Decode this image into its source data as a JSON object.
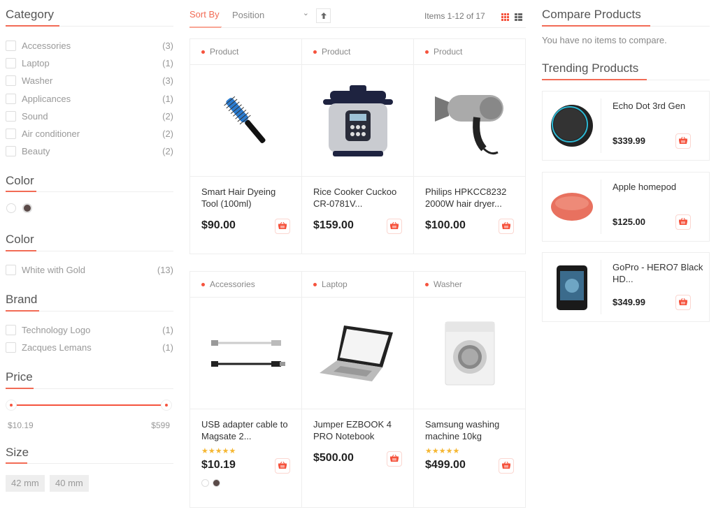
{
  "colors": {
    "accent": "#f5533d",
    "rating": "#f5b733"
  },
  "sidebar": {
    "category": {
      "title": "Category",
      "items": [
        {
          "label": "Accessories",
          "count": "(3)"
        },
        {
          "label": "Laptop",
          "count": "(1)"
        },
        {
          "label": "Washer",
          "count": "(3)"
        },
        {
          "label": "Applicances",
          "count": "(1)"
        },
        {
          "label": "Sound",
          "count": "(2)"
        },
        {
          "label": "Air conditioner",
          "count": "(2)"
        },
        {
          "label": "Beauty",
          "count": "(2)"
        }
      ]
    },
    "color1": {
      "title": "Color",
      "swatches": [
        "#ffffff",
        "#5a4a48"
      ]
    },
    "color2": {
      "title": "Color",
      "items": [
        {
          "label": "White with Gold",
          "count": "(13)"
        }
      ]
    },
    "brand": {
      "title": "Brand",
      "items": [
        {
          "label": "Technology Logo",
          "count": "(1)"
        },
        {
          "label": "Zacques Lemans",
          "count": "(1)"
        }
      ]
    },
    "price": {
      "title": "Price",
      "min": "$10.19",
      "max": "$599",
      "range_min": 10.19,
      "range_max": 599,
      "selected_min": 10.19,
      "selected_max": 599
    },
    "size": {
      "title": "Size",
      "options": [
        "42 mm",
        "40 mm"
      ]
    }
  },
  "toolbar": {
    "sort_label": "Sort By",
    "sort_value": "Position",
    "items_count": "Items 1-12 of 17",
    "view_mode": "grid"
  },
  "products": [
    {
      "category": "Product",
      "name": "Smart Hair Dyeing Tool (100ml)",
      "price": "$90.00",
      "image": "hair-brush",
      "rating": null,
      "swatches": []
    },
    {
      "category": "Product",
      "name": "Rice Cooker Cuckoo CR-0781V...",
      "price": "$159.00",
      "image": "rice-cooker",
      "rating": null,
      "swatches": []
    },
    {
      "category": "Product",
      "name": "Philips HPKCC8232 2000W hair dryer...",
      "price": "$100.00",
      "image": "hair-dryer",
      "rating": null,
      "swatches": []
    },
    {
      "category": "Accessories",
      "name": "USB adapter cable to Magsate 2...",
      "price": "$10.19",
      "image": "usb-cable",
      "rating": 5,
      "swatches": [
        "#ffffff",
        "#5a4a48"
      ]
    },
    {
      "category": "Laptop",
      "name": "Jumper EZBOOK 4 PRO Notebook",
      "price": "$500.00",
      "image": "laptop",
      "rating": null,
      "swatches": []
    },
    {
      "category": "Washer",
      "name": "Samsung washing machine 10kg",
      "price": "$499.00",
      "image": "washing-machine",
      "rating": 5,
      "swatches": []
    }
  ],
  "compare": {
    "title": "Compare Products",
    "empty_text": "You have no items to compare."
  },
  "trending": {
    "title": "Trending Products",
    "items": [
      {
        "name": "Echo Dot 3rd Gen",
        "price": "$339.99",
        "image": "echo-dot"
      },
      {
        "name": "Apple homepod",
        "price": "$125.00",
        "image": "homepod"
      },
      {
        "name": "GoPro - HERO7 Black HD...",
        "price": "$349.99",
        "image": "gopro"
      }
    ]
  }
}
